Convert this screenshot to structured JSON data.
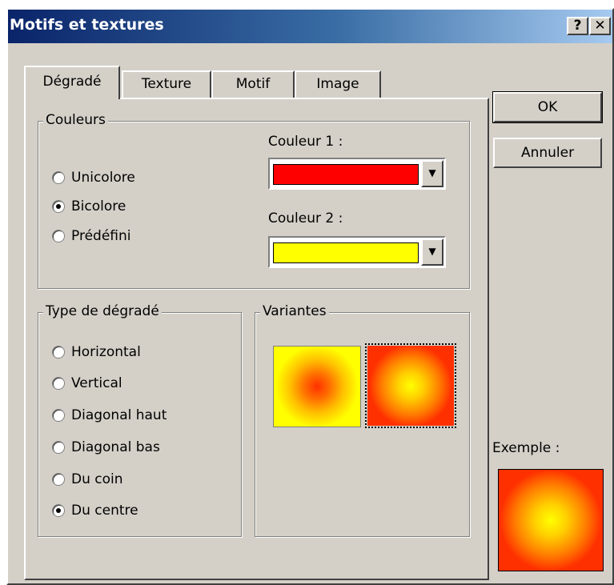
{
  "window": {
    "title": "Motifs et textures",
    "help_label": "?",
    "close_label": "✕"
  },
  "tabs": [
    {
      "label": "Dégradé",
      "active": true
    },
    {
      "label": "Texture",
      "active": false
    },
    {
      "label": "Motif",
      "active": false
    },
    {
      "label": "Image",
      "active": false
    }
  ],
  "couleurs": {
    "legend": "Couleurs",
    "options": [
      {
        "label": "Unicolore",
        "checked": false
      },
      {
        "label": "Bicolore",
        "checked": true
      },
      {
        "label": "Prédéfini",
        "checked": false
      }
    ],
    "couleur1": {
      "label": "Couleur 1 :",
      "color": "#ff0000"
    },
    "couleur2": {
      "label": "Couleur 2 :",
      "color": "#ffff00"
    }
  },
  "type_degrade": {
    "legend": "Type de dégradé",
    "options": [
      {
        "label": "Horizontal",
        "checked": false
      },
      {
        "label": "Vertical",
        "checked": false
      },
      {
        "label": "Diagonal haut",
        "checked": false
      },
      {
        "label": "Diagonal bas",
        "checked": false
      },
      {
        "label": "Du coin",
        "checked": false
      },
      {
        "label": "Du centre",
        "checked": true
      }
    ]
  },
  "variantes": {
    "legend": "Variantes",
    "selected_index": 1
  },
  "buttons": {
    "ok": "OK",
    "cancel": "Annuler"
  },
  "exemple": {
    "label": "Exemple :"
  },
  "colors": {
    "title_start": "#0a246a",
    "title_end": "#a6caf0",
    "dialog_bg": "#d4d0c8",
    "gradient_red": "#ff3000",
    "gradient_yellow": "#ffff00"
  },
  "arrow_icon": "▼"
}
